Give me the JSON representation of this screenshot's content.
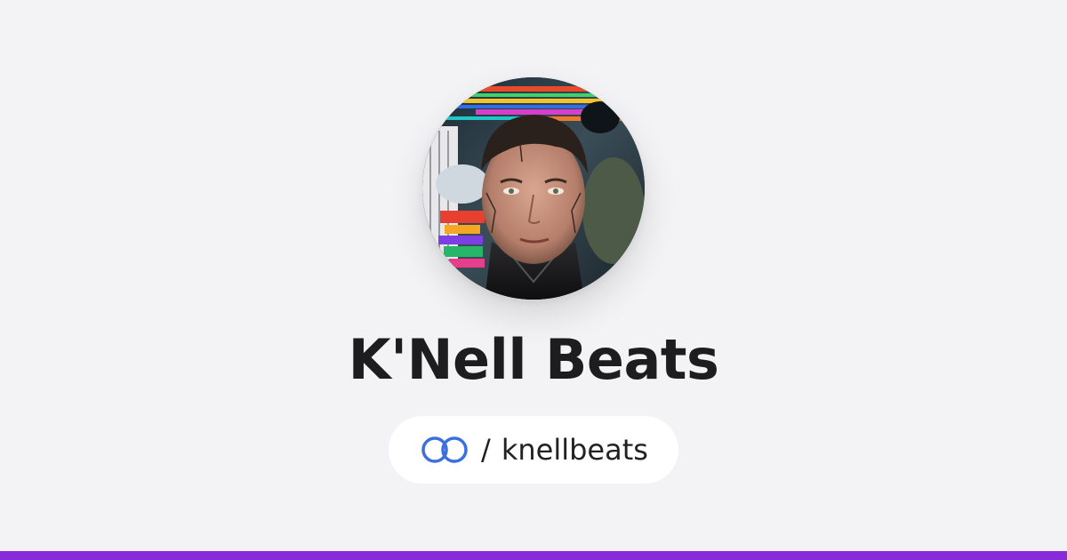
{
  "profile": {
    "name": "K'Nell Beats",
    "separator": "/",
    "handle": "knellbeats"
  },
  "icons": {
    "brand_logo": "linked-rings-icon",
    "avatar": "profile-avatar"
  },
  "colors": {
    "background": "#f3f3f5",
    "accent_bar": "#8a2bd9",
    "logo_blue": "#3b6fe0",
    "text": "#1d1d1f"
  }
}
